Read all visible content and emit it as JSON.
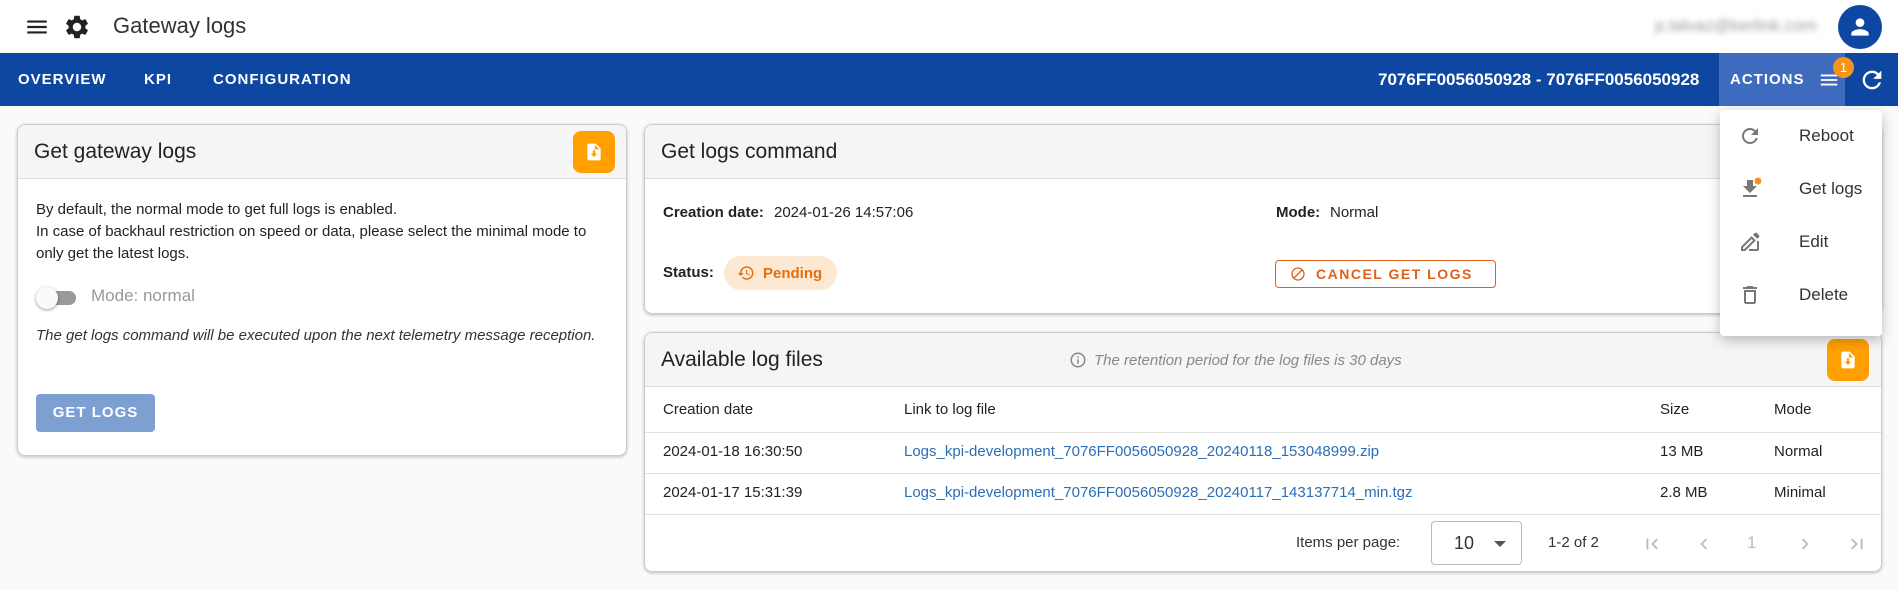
{
  "topbar": {
    "title": "Gateway logs",
    "user_email": "p.talvaz@kerlink.com"
  },
  "navbar": {
    "tabs": [
      "OVERVIEW",
      "KPI",
      "CONFIGURATION"
    ],
    "gateway_id": "7076FF0056050928 - 7076FF0056050928",
    "actions_label": "ACTIONS",
    "actions_badge": "1"
  },
  "get_gateway_logs": {
    "title": "Get gateway logs",
    "description_1": "By default, the normal mode to get full logs is enabled.",
    "description_2": "In case of backhaul restriction on speed or data, please select the minimal mode to only get the latest logs.",
    "toggle_label": "Mode: normal",
    "note": "The get logs command will be executed upon the next telemetry message reception.",
    "button_label": "GET LOGS"
  },
  "get_logs_command": {
    "title": "Get logs command",
    "creation_date_key": "Creation date:",
    "creation_date_val": "2024-01-26 14:57:06",
    "mode_key": "Mode:",
    "mode_val": "Normal",
    "status_key": "Status:",
    "status_val": "Pending",
    "cancel_label": "CANCEL GET LOGS"
  },
  "available_log_files": {
    "title": "Available log files",
    "retention_note": "The retention period for the log files is 30 days",
    "columns": [
      "Creation date",
      "Link to log file",
      "Size",
      "Mode"
    ],
    "rows": [
      [
        "2024-01-18 16:30:50",
        "Logs_kpi-development_7076FF0056050928_20240118_153048999.zip",
        "13 MB",
        "Normal"
      ],
      [
        "2024-01-17 15:31:39",
        "Logs_kpi-development_7076FF0056050928_20240117_143137714_min.tgz",
        "2.8 MB",
        "Minimal"
      ]
    ],
    "items_per_page_label": "Items per page:",
    "items_per_page": "10",
    "range": "1-2 of 2",
    "page": "1"
  },
  "actions_menu": {
    "items": [
      "Reboot",
      "Get logs",
      "Edit",
      "Delete"
    ]
  },
  "colors": {
    "primary": "#0d47a1",
    "accent": "#ffa000",
    "pending": "#e07010",
    "link": "#2a6fb7"
  }
}
